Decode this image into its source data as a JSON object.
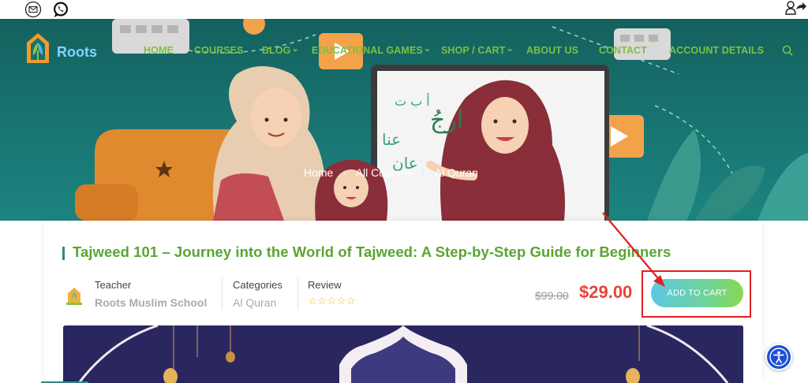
{
  "header": {
    "logo_text": "Roots",
    "nav": [
      {
        "label": "HOME",
        "caret": false
      },
      {
        "label": "COURSES",
        "caret": false
      },
      {
        "label": "BLOG",
        "caret": true
      },
      {
        "label": "EDUCATIONAL GAMES",
        "caret": true
      },
      {
        "label": "SHOP / CART",
        "caret": true
      },
      {
        "label": "ABOUT US",
        "caret": false
      },
      {
        "label": "CONTACT",
        "caret": false
      },
      {
        "label": "ACCOUNT DETAILS",
        "caret": false
      }
    ],
    "icons": [
      "mail-icon",
      "whatsapp-icon",
      "user-share-icon",
      "search-icon"
    ]
  },
  "hero": {
    "breadcrumb": [
      "Home",
      "All Courses",
      "Al Quran"
    ],
    "board_text": [
      "أ ب ت",
      "ارجُ",
      "عنا",
      "عان"
    ]
  },
  "course": {
    "title": "Tajweed 101 – Journey into the World of Tajweed: A Step-by-Step Guide for Beginners",
    "teacher_label": "Teacher",
    "teacher_value": "Roots Muslim School",
    "categories_label": "Categories",
    "categories_value": "Al Quran",
    "review_label": "Review",
    "review_stars": "☆☆☆☆☆",
    "rating": 0,
    "old_price": "$99.00",
    "new_price": "$29.00",
    "add_to_cart": "ADD TO CART"
  },
  "colors": {
    "accent_green": "#5aa532",
    "price_red": "#e8443a",
    "hero_teal": "#187572",
    "highlight_red": "#e02020",
    "accessibility_blue": "#1c4fd6"
  }
}
